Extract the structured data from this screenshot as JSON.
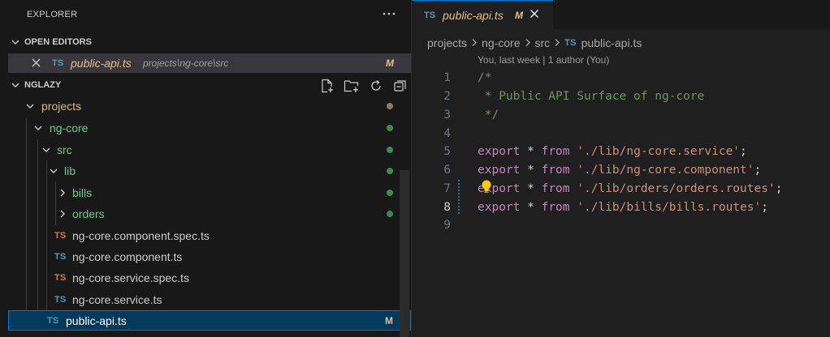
{
  "sidebar": {
    "title": "EXPLORER",
    "more_icon": "ellipsis-icon",
    "open_editors": {
      "heading": "OPEN EDITORS",
      "items": [
        {
          "lang": "TS",
          "name": "public-api.ts",
          "path": "projects\\ng-core\\src",
          "status": "M"
        }
      ]
    },
    "workspace": {
      "heading": "NGLAZY",
      "actions": [
        "new-file-icon",
        "new-folder-icon",
        "refresh-icon",
        "collapse-all-icon"
      ]
    },
    "tree": [
      {
        "label": "projects",
        "type": "folder"
      },
      {
        "label": "ng-core",
        "type": "folder"
      },
      {
        "label": "src",
        "type": "folder"
      },
      {
        "label": "lib",
        "type": "folder"
      },
      {
        "label": "bills",
        "type": "folder"
      },
      {
        "label": "orders",
        "type": "folder"
      },
      {
        "label": "ng-core.component.spec.ts",
        "lang": "TS"
      },
      {
        "label": "ng-core.component.ts",
        "lang": "TS"
      },
      {
        "label": "ng-core.service.spec.ts",
        "lang": "TS"
      },
      {
        "label": "ng-core.service.ts",
        "lang": "TS"
      },
      {
        "label": "public-api.ts",
        "lang": "TS",
        "status": "M",
        "selected": true
      }
    ]
  },
  "editor": {
    "tab": {
      "lang": "TS",
      "name": "public-api.ts",
      "status": "M"
    },
    "breadcrumb": [
      "projects",
      "ng-core",
      "src",
      "public-api.ts"
    ],
    "breadcrumb_lang": "TS",
    "codelens": "You, last week | 1 author (You)",
    "lines": [
      {
        "num": "1",
        "text": "/*"
      },
      {
        "num": "2",
        "text": " * Public API Surface of ng-core"
      },
      {
        "num": "3",
        "text": " */"
      },
      {
        "num": "4",
        "text": ""
      },
      {
        "num": "5",
        "kw": "export",
        "op": " * ",
        "from": "from",
        "str": "'./lib/ng-core.service'",
        "end": ";"
      },
      {
        "num": "6",
        "kw": "export",
        "op": " * ",
        "from": "from",
        "str": "'./lib/ng-core.component'",
        "end": ";"
      },
      {
        "num": "7",
        "kw": "export",
        "op": " * ",
        "from": "from",
        "str": "'./lib/orders/orders.routes'",
        "end": ";"
      },
      {
        "num": "8",
        "kw": "export",
        "op": " * ",
        "from": "from",
        "str": "'./lib/bills/bills.routes'",
        "end": ";"
      },
      {
        "num": "9",
        "text": ""
      }
    ]
  },
  "colors": {
    "accent": "#0078d4",
    "modified": "#e2c08d",
    "git_added_dot": "#3d8a4a",
    "git_dot_projects": "#8b7d5e",
    "ts_blue": "#519aba",
    "ts_orange": "#e37933",
    "folder_green": "#73c991"
  }
}
